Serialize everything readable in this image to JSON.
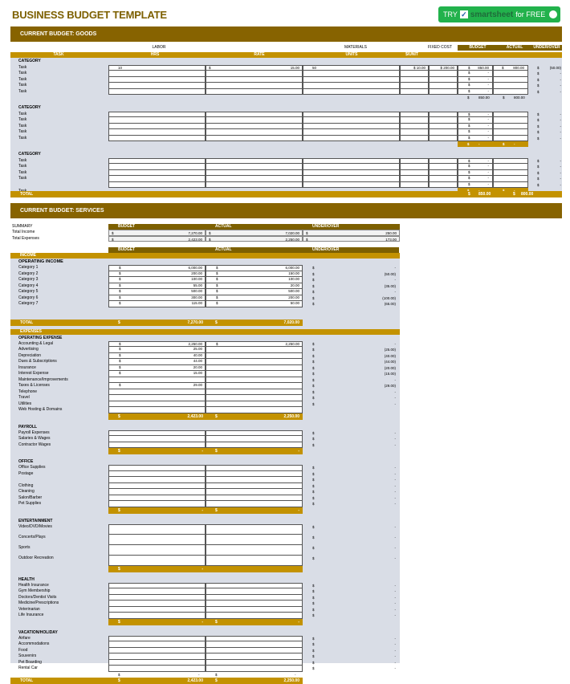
{
  "title": "BUSINESS BUDGET TEMPLATE",
  "cta": {
    "try": "TRY",
    "brand": "smartsheet",
    "suffix": "for FREE",
    "check_icon": "checkbox-icon",
    "hand_icon": "hand-pointer-icon"
  },
  "goods": {
    "section_title": "CURRENT BUDGET: GOODS",
    "group_headers": {
      "labor": "LABOR",
      "materials": "MATERIALS",
      "fixed_cost": "FIXED COST",
      "budget": "BUDGET",
      "actual": "ACTUAL",
      "under_over": "UNDER/OVER"
    },
    "columns": {
      "task": "TASK",
      "hrs": "HRS",
      "rate": "RATE",
      "units": "UNITS",
      "per_unit": "$/UNIT"
    },
    "categories": [
      {
        "label": "CATEGORY",
        "rows": [
          {
            "task": "Task",
            "hrs": "10",
            "rate_sym": "$",
            "rate": "15.00",
            "units": "50",
            "per_unit": "$ 10.00",
            "fixed": "$ 200.00",
            "budget_sym": "$",
            "budget": "850.00",
            "actual_sym": "$",
            "actual": "800.00",
            "uo_sym": "$",
            "uo": "(50.00)"
          },
          {
            "task": "Task",
            "hrs": "",
            "rate_sym": "",
            "rate": "",
            "units": "",
            "per_unit": "",
            "fixed": "",
            "budget_sym": "$",
            "budget": "-",
            "actual_sym": "",
            "actual": "",
            "uo_sym": "$",
            "uo": "-"
          },
          {
            "task": "Task",
            "hrs": "",
            "rate_sym": "",
            "rate": "",
            "units": "",
            "per_unit": "",
            "fixed": "",
            "budget_sym": "$",
            "budget": "-",
            "actual_sym": "",
            "actual": "",
            "uo_sym": "$",
            "uo": "-"
          },
          {
            "task": "Task",
            "hrs": "",
            "rate_sym": "",
            "rate": "",
            "units": "",
            "per_unit": "",
            "fixed": "",
            "budget_sym": "$",
            "budget": "-",
            "actual_sym": "",
            "actual": "",
            "uo_sym": "$",
            "uo": "-"
          },
          {
            "task": "Task",
            "hrs": "",
            "rate_sym": "",
            "rate": "",
            "units": "",
            "per_unit": "",
            "fixed": "",
            "budget_sym": "$",
            "budget": "-",
            "actual_sym": "",
            "actual": "",
            "uo_sym": "$",
            "uo": "-"
          }
        ],
        "subtotal": {
          "budget_sym": "$",
          "budget": "850.00",
          "actual_sym": "$",
          "actual": "800.00"
        },
        "subtotal_style": "plain"
      },
      {
        "label": "CATEGORY",
        "rows": [
          {
            "task": "Task",
            "budget_sym": "$",
            "budget": "-",
            "uo_sym": "$",
            "uo": "-"
          },
          {
            "task": "Task",
            "budget_sym": "$",
            "budget": "-",
            "uo_sym": "$",
            "uo": "-"
          },
          {
            "task": "Task",
            "budget_sym": "$",
            "budget": "-",
            "uo_sym": "$",
            "uo": "-"
          },
          {
            "task": "Task",
            "budget_sym": "$",
            "budget": "-",
            "uo_sym": "$",
            "uo": "-"
          },
          {
            "task": "Task",
            "budget_sym": "$",
            "budget": "-",
            "uo_sym": "$",
            "uo": "-"
          }
        ],
        "subtotal": {
          "budget_sym": "$",
          "budget": "-",
          "actual_sym": "$",
          "actual": "-"
        },
        "subtotal_style": "gold"
      },
      {
        "label": "CATEGORY",
        "rows": [
          {
            "task": "Task",
            "budget_sym": "$",
            "budget": "-",
            "uo_sym": "$",
            "uo": "-"
          },
          {
            "task": "Task",
            "budget_sym": "$",
            "budget": "-",
            "uo_sym": "$",
            "uo": "-"
          },
          {
            "task": "Task",
            "budget_sym": "$",
            "budget": "-",
            "uo_sym": "$",
            "uo": "-"
          },
          {
            "task": "Task",
            "budget_sym": "$",
            "budget": "-",
            "uo_sym": "$",
            "uo": "-"
          },
          {
            "task": "",
            "budget_sym": "$",
            "budget": "-",
            "uo_sym": "$",
            "uo": "-"
          }
        ],
        "trailing_task": "Task",
        "subtotal": {
          "budget_sym": "$",
          "budget": "-",
          "actual_sym": "$",
          "actual": "-"
        },
        "subtotal_style": "gold"
      }
    ],
    "total": {
      "label": "TOTAL",
      "budget_sym": "$",
      "budget": "850.00",
      "actual_sym": "$",
      "actual": "800.00"
    }
  },
  "services": {
    "section_title": "CURRENT BUDGET: SERVICES",
    "summary": {
      "label": "SUMMARY",
      "headers": {
        "budget": "BUDGET",
        "actual": "ACTUAL",
        "under_over": "UNDER/OVER"
      },
      "rows": [
        {
          "label": "Total Income",
          "budget": "7,270.00",
          "actual": "7,020.00",
          "uo": "250.00"
        },
        {
          "label": "Total Expenses",
          "budget": "2,423.00",
          "actual": "2,250.00",
          "uo": "173.00"
        }
      ]
    },
    "headers": {
      "budget": "BUDGET",
      "actual": "ACTUAL",
      "under_over": "UNDER/OVER"
    },
    "income": {
      "label": "INCOME",
      "group": "OPERATING INCOME",
      "rows": [
        {
          "label": "Category 1",
          "budget": "6,000.00",
          "actual": "6,000.00",
          "uo": "-"
        },
        {
          "label": "Category 2",
          "budget": "200.00",
          "actual": "150.00",
          "uo": "(50.00)"
        },
        {
          "label": "Category 3",
          "budget": "100.00",
          "actual": "100.00",
          "uo": "-"
        },
        {
          "label": "Category 4",
          "budget": "55.00",
          "actual": "20.00",
          "uo": "(35.00)"
        },
        {
          "label": "Category 5",
          "budget": "500.00",
          "actual": "500.00",
          "uo": "-"
        },
        {
          "label": "Category 6",
          "budget": "300.00",
          "actual": "200.00",
          "uo": "(100.00)"
        },
        {
          "label": "Category 7",
          "budget": "115.00",
          "actual": "50.00",
          "uo": "(65.00)"
        }
      ],
      "total": {
        "label": "TOTAL",
        "budget": "7,270.00",
        "actual": "7,020.00"
      }
    },
    "expenses": {
      "label": "EXPENSES",
      "groups": [
        {
          "label": "OPERATING EXPENSE",
          "rows": [
            {
              "label": "Accounting & Legal",
              "budget": "2,250.00",
              "actual": "2,250.00",
              "uo": "-"
            },
            {
              "label": "Advertising",
              "budget": "25.00",
              "actual": "",
              "uo": "(25.00)"
            },
            {
              "label": "Depreciation",
              "budget": "40.00",
              "actual": "",
              "uo": "(40.00)"
            },
            {
              "label": "Dues & Subscriptions",
              "budget": "44.00",
              "actual": "",
              "uo": "(44.00)"
            },
            {
              "label": "Insurance",
              "budget": "20.00",
              "actual": "",
              "uo": "(20.00)"
            },
            {
              "label": "Interest Expense",
              "budget": "15.00",
              "actual": "",
              "uo": "(15.00)"
            },
            {
              "label": "Maintenance/Improvements",
              "budget": "",
              "actual": "",
              "uo": "-"
            },
            {
              "label": "Taxes & Licenses",
              "budget": "29.00",
              "actual": "",
              "uo": "(29.00)"
            },
            {
              "label": "Telephone",
              "budget": "",
              "actual": "",
              "uo": "-"
            },
            {
              "label": "Travel",
              "budget": "",
              "actual": "",
              "uo": "-"
            },
            {
              "label": "Utilities",
              "budget": "",
              "actual": "",
              "uo": "-"
            },
            {
              "label": "Web Hosting & Domains",
              "budget": "",
              "actual": "",
              "uo": ""
            }
          ],
          "subtotal": {
            "budget": "2,423.00",
            "actual": "2,250.00"
          }
        },
        {
          "label": "PAYROLL",
          "rows": [
            {
              "label": "Payroll Expenses",
              "budget": "",
              "actual": "",
              "uo": "-"
            },
            {
              "label": "Salaries & Wages",
              "budget": "",
              "actual": "",
              "uo": "-"
            },
            {
              "label": "Contractor Wages",
              "budget": "",
              "actual": "",
              "uo": "-"
            }
          ],
          "subtotal": {
            "budget": "-",
            "actual": "-"
          }
        },
        {
          "label": "OFFICE",
          "rows": [
            {
              "label": "Office Supplies",
              "budget": "",
              "actual": "",
              "uo": "-"
            },
            {
              "label": "Postage",
              "budget": "",
              "actual": "",
              "uo": "-"
            },
            {
              "label": "",
              "budget": "",
              "actual": "",
              "uo": "-"
            },
            {
              "label": "Clothing",
              "budget": "",
              "actual": "",
              "uo": "-"
            },
            {
              "label": "Cleaning",
              "budget": "",
              "actual": "",
              "uo": "-"
            },
            {
              "label": "Salon/Barber",
              "budget": "",
              "actual": "",
              "uo": "-"
            },
            {
              "label": "Pet Supplies",
              "budget": "",
              "actual": "",
              "uo": "-"
            }
          ],
          "subtotal": {
            "budget": "-",
            "actual": "-"
          }
        },
        {
          "label": "ENTERTAINMENT",
          "rows": [
            {
              "label": "Video/DVD/Movies",
              "budget": "",
              "actual": "",
              "uo": "-"
            },
            {
              "label": "Concerts/Plays",
              "budget": "",
              "actual": "",
              "uo": "-"
            },
            {
              "label": "Sports",
              "budget": "",
              "actual": "",
              "uo": "-"
            },
            {
              "label": "Outdoor Recreation",
              "budget": "",
              "actual": "",
              "uo": "-"
            }
          ],
          "subtotal": {
            "budget": "-",
            "actual": ""
          }
        },
        {
          "label": "HEALTH",
          "rows": [
            {
              "label": "Health Insurance",
              "budget": "",
              "actual": "",
              "uo": "-"
            },
            {
              "label": "Gym Membership",
              "budget": "",
              "actual": "",
              "uo": "-"
            },
            {
              "label": "Doctors/Dentist Visits",
              "budget": "",
              "actual": "",
              "uo": "-"
            },
            {
              "label": "Medicine/Prescriptions",
              "budget": "",
              "actual": "",
              "uo": "-"
            },
            {
              "label": "Veterinarian",
              "budget": "",
              "actual": "",
              "uo": "-"
            },
            {
              "label": "Life Insurance",
              "budget": "",
              "actual": "",
              "uo": "-"
            }
          ],
          "subtotal": {
            "budget": "-",
            "actual": "-"
          }
        },
        {
          "label": "VACATION/HOLIDAY",
          "rows": [
            {
              "label": "Airfare",
              "budget": "",
              "actual": "",
              "uo": "-"
            },
            {
              "label": "Accommodations",
              "budget": "",
              "actual": "",
              "uo": "-"
            },
            {
              "label": "Food",
              "budget": "",
              "actual": "",
              "uo": "-"
            },
            {
              "label": "Souvenirs",
              "budget": "",
              "actual": "",
              "uo": "-"
            },
            {
              "label": "Pet Boarding",
              "budget": "",
              "actual": "",
              "uo": "-"
            },
            {
              "label": "Rental Car",
              "budget": "",
              "actual": "",
              "uo": "-"
            }
          ],
          "subtotal": {
            "budget": "-",
            "actual": "-"
          }
        }
      ],
      "total": {
        "label": "TOTAL",
        "budget": "2,423.00",
        "actual": "2,250.00"
      }
    },
    "currency": "$"
  },
  "colors": {
    "brown": "#876300",
    "gold": "#c39200",
    "panel": "#d9dde6",
    "cta_green": "#22b24c"
  }
}
